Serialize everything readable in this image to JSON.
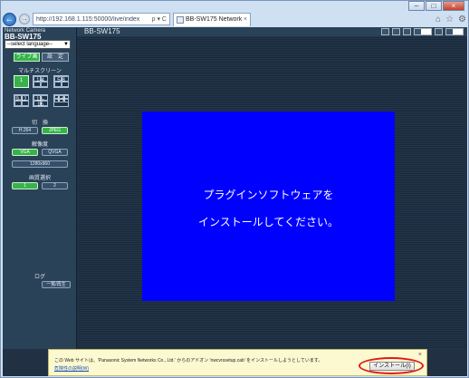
{
  "browser": {
    "address_url": "http://192.168.1.115:50000/live/index",
    "address_tools": "ρ ▾ C",
    "tab_title": "BB-SW175 Network Ca...",
    "tab_close": "×",
    "back_glyph": "←",
    "forward_glyph": "→",
    "right_icons": [
      "⌂",
      "☆",
      "⚙"
    ],
    "window_buttons": [
      "–",
      "□",
      "×"
    ]
  },
  "left_panel": {
    "brand": "Network Camera",
    "model": "BB-SW175",
    "language_select": "--select language--",
    "live_tab": "ライブ画",
    "setup_tab": "設　定",
    "multiscreen_label": "マルチスクリーン",
    "grid_labels": [
      "1",
      "1-4",
      "5-8",
      "9-12",
      "13-16",
      "1-9",
      "10-16",
      "1-16"
    ],
    "switch_label": "切　換",
    "switch_buttons": [
      "H.264",
      "JPEG"
    ],
    "resolution_label": "解像度",
    "resolution_buttons": [
      "VGA",
      "QVGA",
      "1280x960"
    ],
    "quality_label": "画質選択",
    "quality_buttons": [
      "1",
      "2"
    ],
    "log_label": "ログ",
    "log_button": "一覧/再生"
  },
  "topbar": {
    "camera_name": "BB-SW175",
    "tool_icons": [
      "snapshot-icon",
      "camera-icon",
      "zoom-icon",
      "brightness-icon"
    ]
  },
  "viewer": {
    "message_line1": "プラグインソフトウェアを",
    "message_line2": "インストールしてください。",
    "box_color": "#0000ff"
  },
  "notification": {
    "text": "この Web サイトは、'Panasonic System Networks Co., Ltd.' からのアドオン 'nwcvrssetup.cab' をインストールしようとしています。",
    "link": "危険性の説明(W)",
    "install_button": "インストール(I)",
    "close_glyph": "×"
  },
  "colors": {
    "active_green": "#37b34a",
    "panel_bg": "#2a4257",
    "highlight_red": "#e01b1b"
  }
}
